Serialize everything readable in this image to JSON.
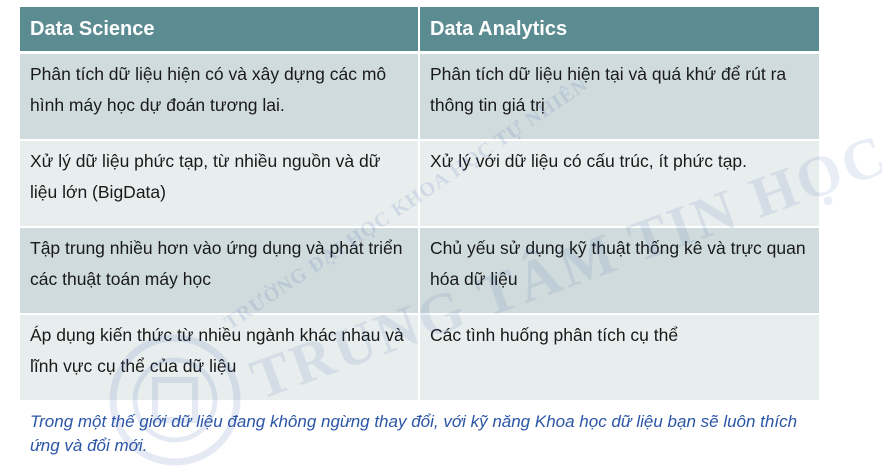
{
  "table": {
    "headers": [
      "Data Science",
      "Data Analytics"
    ],
    "rows": [
      [
        "Phân tích dữ liệu hiện có và xây dựng các mô hình máy học dự đoán tương lai.",
        "Phân tích dữ liệu hiện tại và quá khứ để rút ra thông tin giá trị"
      ],
      [
        "Xử lý  dữ liệu phức tạp, từ nhiều nguồn và dữ liệu lớn (BigData)",
        "Xử lý với dữ liệu có cấu trúc, ít phức tạp."
      ],
      [
        "Tập trung nhiều hơn vào ứng dụng và phát triển các thuật toán máy học",
        "Chủ yếu sử dụng kỹ thuật thống kê và trực quan hóa dữ liệu"
      ],
      [
        "Áp dụng kiến thức từ nhiều ngành khác nhau và lĩnh vực cụ thể của dữ liệu",
        "Các tình huống phân tích cụ thể"
      ]
    ]
  },
  "footer_text": "Trong một thế giới dữ liệu đang không ngừng thay đổi, với kỹ năng Khoa học dữ liệu bạn sẽ luôn thích ứng và đổi mới.",
  "watermark": {
    "line1": "TRƯỜNG ĐẠI HỌC KHOA HỌC TỰ NHIÊN",
    "line2": "TRUNG TÂM TIN HỌC"
  },
  "colors": {
    "header_bg": "#5b8c92",
    "row_odd_bg": "#cfdbdc",
    "row_even_bg": "#e8eeee",
    "footer_text": "#2b56a6"
  }
}
